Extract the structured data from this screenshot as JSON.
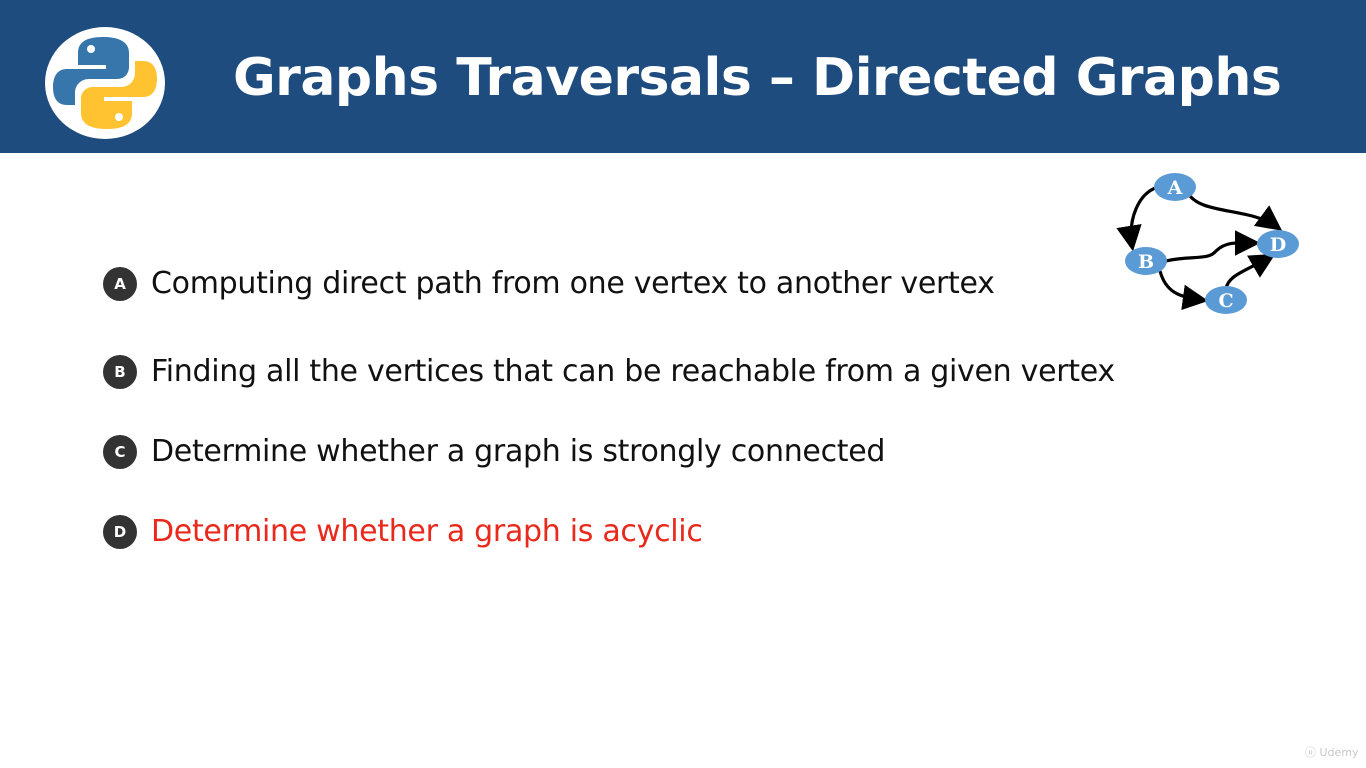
{
  "header": {
    "title": "Graphs Traversals – Directed Graphs",
    "logo_icon": "python-logo-icon",
    "background_color": "#1f4c7e"
  },
  "items": [
    {
      "badge": "A",
      "text": "Computing direct path from one vertex to another vertex"
    },
    {
      "badge": "B",
      "text": "Finding all the vertices that can be reachable from a given vertex"
    },
    {
      "badge": "C",
      "text": "Determine whether a graph is strongly connected"
    },
    {
      "badge": "D",
      "text": "Determine whether a graph is acyclic",
      "highlighted": true,
      "color": "#e8291c"
    }
  ],
  "graph": {
    "nodes": [
      "A",
      "B",
      "C",
      "D"
    ],
    "edges": [
      [
        "A",
        "B"
      ],
      [
        "A",
        "D"
      ],
      [
        "B",
        "D"
      ],
      [
        "B",
        "C"
      ],
      [
        "C",
        "D"
      ]
    ],
    "node_color": "#5b9bd5"
  },
  "watermark": {
    "icon": "udemy-logo-icon",
    "text": "Udemy"
  }
}
